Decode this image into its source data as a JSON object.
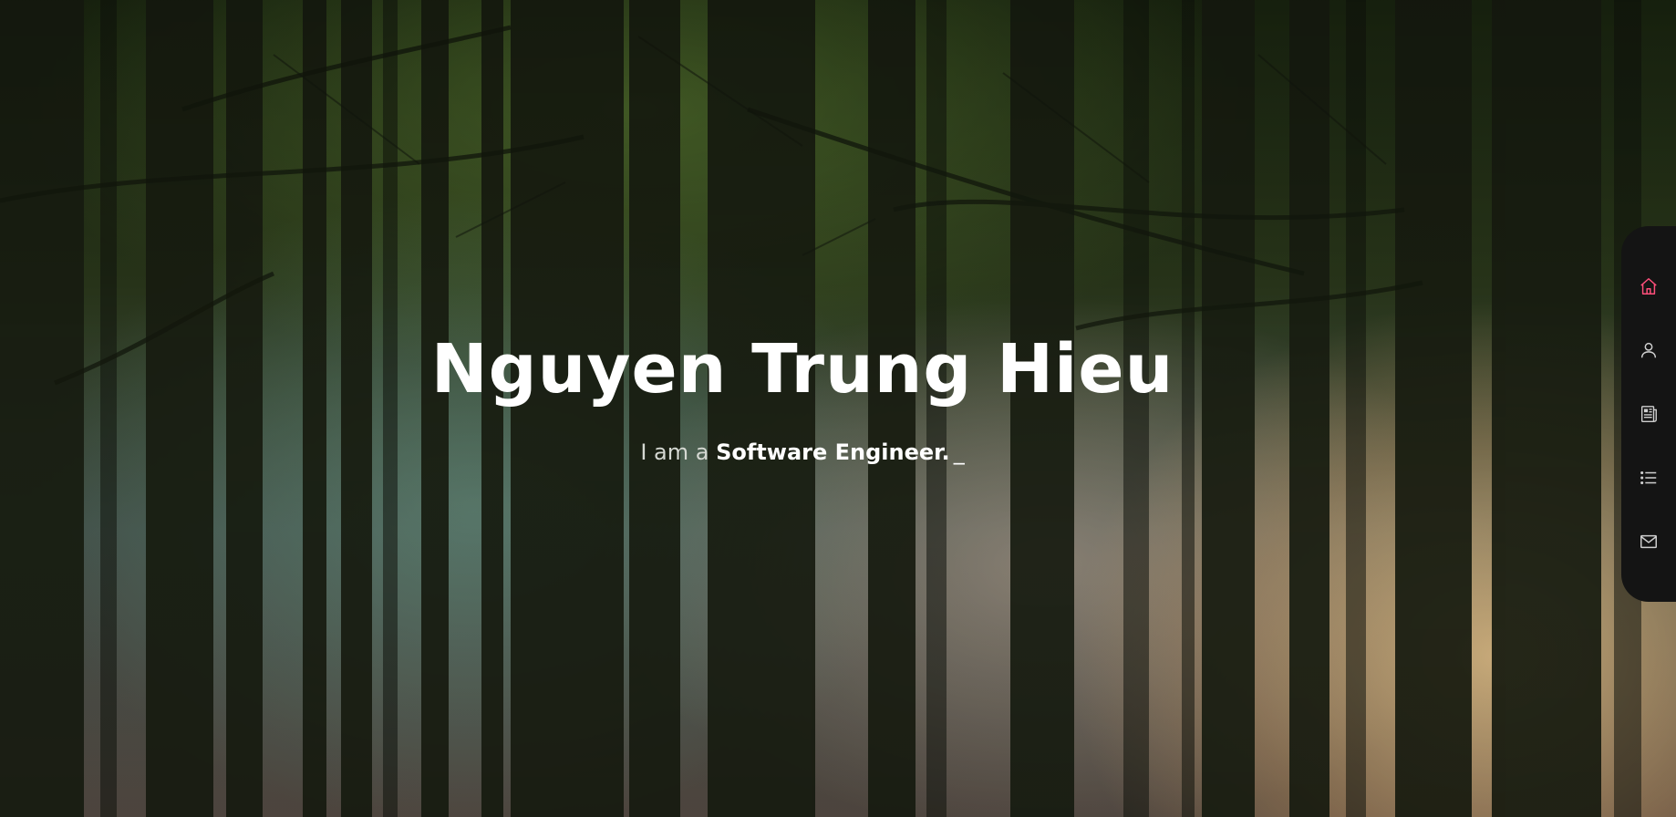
{
  "hero": {
    "name": "Nguyen Trung Hieu",
    "intro": "I am a",
    "role": "Software Engineer.",
    "cursor": "_"
  },
  "side_nav": {
    "items": [
      {
        "icon": "home-icon",
        "active": true
      },
      {
        "icon": "user-icon",
        "active": false
      },
      {
        "icon": "resume-icon",
        "active": false
      },
      {
        "icon": "list-icon",
        "active": false
      },
      {
        "icon": "mail-icon",
        "active": false
      }
    ]
  },
  "colors": {
    "accent": "#ff4f7b",
    "icon": "#d0d0d0",
    "nav_bg": "#141414"
  }
}
